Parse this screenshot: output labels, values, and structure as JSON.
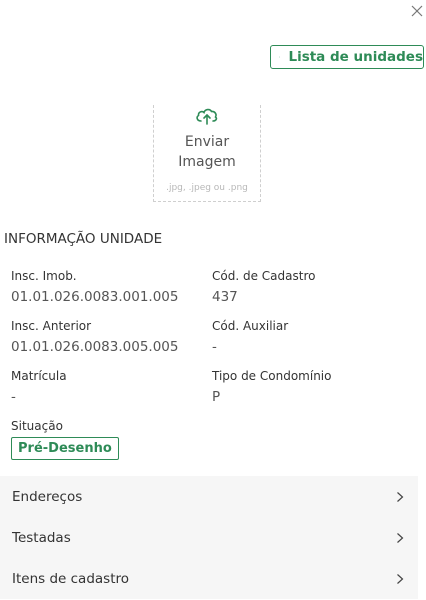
{
  "header": {
    "units_button_label": "Lista de unidades"
  },
  "upload": {
    "label": "Enviar Imagem",
    "hint": ".jpg, .jpeg ou .png"
  },
  "section": {
    "title": "INFORMAÇÃO UNIDADE"
  },
  "fields": {
    "insc_imob": {
      "label": "Insc. Imob.",
      "value": "01.01.026.0083.001.005"
    },
    "cod_cadastro": {
      "label": "Cód. de Cadastro",
      "value": "437"
    },
    "insc_anterior": {
      "label": "Insc. Anterior",
      "value": "01.01.026.0083.005.005"
    },
    "cod_auxiliar": {
      "label": "Cód. Auxiliar",
      "value": "-"
    },
    "matricula": {
      "label": "Matrícula",
      "value": "-"
    },
    "tipo_condominio": {
      "label": "Tipo de Condomínio",
      "value": "P"
    },
    "situacao": {
      "label": "Situação",
      "value": "Pré-Desenho"
    }
  },
  "menu": {
    "items": [
      {
        "label": "Endereços"
      },
      {
        "label": "Testadas"
      },
      {
        "label": "Itens de cadastro"
      }
    ]
  },
  "colors": {
    "accent": "#2e8b57",
    "menu_background": "#f6f6f6"
  },
  "icons": {
    "close": "close-icon",
    "list": "list-icon",
    "upload": "cloud-upload-icon",
    "chevron": "chevron-right-icon"
  }
}
